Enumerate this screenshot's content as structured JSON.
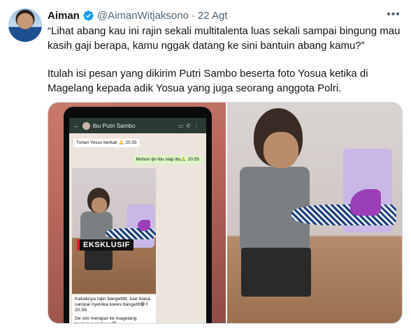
{
  "author": {
    "name": "Aiman",
    "handle": "@AimanWitjaksono",
    "separator": "·",
    "date": "22 Agt",
    "verified": true,
    "avatar_icon": "avatar-photo"
  },
  "tweet": {
    "paragraphs": [
      "“Lihat abang kau ini rajin sekali multitalenta luas sekali sampai bingung mau kasih gaji berapa, kamu nggak datang ke sini bantuin abang kamu?”",
      "Itulah isi pesan yang dikirim Putri Sambo beserta foto Yosua ketika di Magelang kepada adik Yosua yang juga seorang anggota Polri."
    ]
  },
  "media": {
    "badge": "EKSKLUSIF",
    "chat": {
      "contact": "Ibu Putri Sambo",
      "messages": [
        "Tuhan Yesus berkati 🙏  20.55",
        "Mohon ijin ibu siap ibu🙏  20.55",
        "Kakaknya rajin bangettttt..luar biasa sampai nyetrika luwes bangettt😁✌  20.56",
        "De sini merapat ke magelang bantuin kakaknya😁"
      ]
    }
  },
  "colors": {
    "text": "#0f1419",
    "secondary": "#536471",
    "verified": "#1d9bf0",
    "border": "#cfd9de",
    "badge_accent": "#e11d2a"
  }
}
